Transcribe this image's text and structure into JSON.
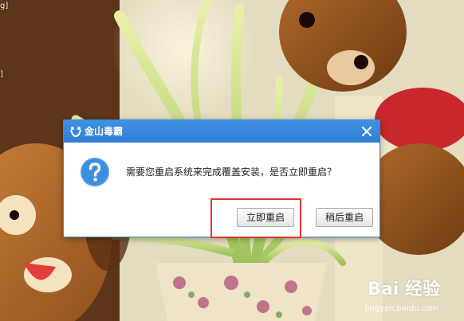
{
  "dialog": {
    "title": "金山毒霸",
    "message": "需要您重启系统来完成覆盖安装，是否立即重启？",
    "restart_now_label": "立即重启",
    "restart_later_label": "稍后重启",
    "close_icon": "close-icon",
    "app_icon": "kingsoft-antivirus-logo-icon",
    "message_icon": "question-icon"
  },
  "colors": {
    "titlebar": "#2f7fd6",
    "highlight_border": "#e0332d",
    "question_icon": "#3b8fe0"
  },
  "watermark": {
    "brand": "Bai 经验",
    "url": "jingyan.baidu.com"
  },
  "desktop": {
    "edge_text_top": "g]",
    "edge_text_mid": "]"
  }
}
